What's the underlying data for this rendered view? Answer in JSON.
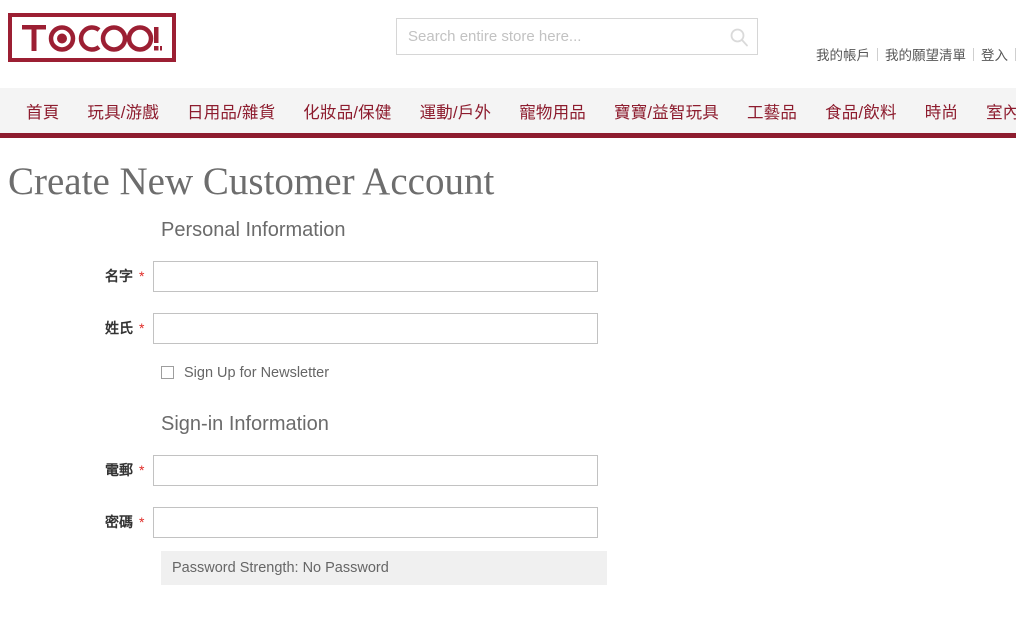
{
  "header": {
    "logo": {
      "name": "tocoo-logo",
      "text": "TOCOO!",
      "border_color": "#9c1f33"
    },
    "search": {
      "placeholder": "Search entire store here...",
      "value": "",
      "icon": "search-icon"
    },
    "account_links": [
      {
        "label": "我的帳戶"
      },
      {
        "label": "我的願望清單"
      },
      {
        "label": "登入"
      }
    ]
  },
  "nav": {
    "accent_color": "#8d1c2e",
    "background": "#f4f4f4",
    "items": [
      {
        "label": "首頁"
      },
      {
        "label": "玩具/游戲"
      },
      {
        "label": "日用品/雜貨"
      },
      {
        "label": "化妝品/保健"
      },
      {
        "label": "運動/戶外"
      },
      {
        "label": "寵物用品"
      },
      {
        "label": "寶寶/益智玩具"
      },
      {
        "label": "工藝品"
      },
      {
        "label": "食品/飲料"
      },
      {
        "label": "時尚"
      },
      {
        "label": "室內裝飾品"
      }
    ]
  },
  "page": {
    "title": "Create New Customer Account"
  },
  "form": {
    "personal_section": {
      "legend": "Personal Information",
      "firstname": {
        "label": "名字",
        "required": "*",
        "value": ""
      },
      "lastname": {
        "label": "姓氏",
        "required": "*",
        "value": ""
      },
      "newsletter": {
        "label": "Sign Up for Newsletter",
        "checked": false
      }
    },
    "signin_section": {
      "legend": "Sign-in Information",
      "email": {
        "label": "電郵",
        "required": "*",
        "value": ""
      },
      "password": {
        "label": "密碼",
        "required": "*",
        "value": ""
      },
      "password_strength": "Password Strength: No Password"
    }
  }
}
